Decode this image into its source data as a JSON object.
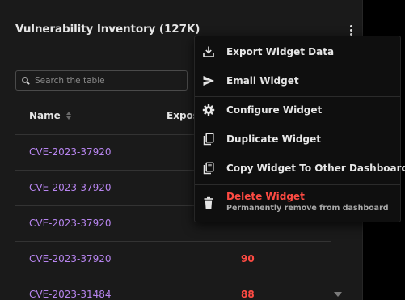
{
  "widget": {
    "title": "Vulnerability Inventory (127K)",
    "search_placeholder": "Search the table"
  },
  "table": {
    "columns": [
      "Name",
      "Expos"
    ],
    "rows": [
      {
        "name": "CVE-2023-37920",
        "score": ""
      },
      {
        "name": "CVE-2023-37920",
        "score": ""
      },
      {
        "name": "CVE-2023-37920",
        "score": ""
      },
      {
        "name": "CVE-2023-37920",
        "score": "90"
      },
      {
        "name": "CVE-2023-31484",
        "score": "88"
      }
    ]
  },
  "menu": {
    "items": [
      {
        "label": "Export Widget Data",
        "icon": "download-icon"
      },
      {
        "label": "Email Widget",
        "icon": "send-icon"
      },
      {
        "label": "Configure Widget",
        "icon": "gear-icon"
      },
      {
        "label": "Duplicate Widget",
        "icon": "copy-icon"
      },
      {
        "label": "Copy Widget To Other Dashboard",
        "icon": "copy-to-dashboard-icon"
      }
    ],
    "delete": {
      "label": "Delete Widget",
      "sublabel": "Permanently remove from dashboard",
      "icon": "trash-icon"
    }
  },
  "colors": {
    "background": "#000000",
    "panel": "#1a1a1a",
    "menu_bg": "#0f0f0f",
    "link": "#b785ef",
    "danger": "#ff4b43",
    "text": "#e6e6e6"
  }
}
